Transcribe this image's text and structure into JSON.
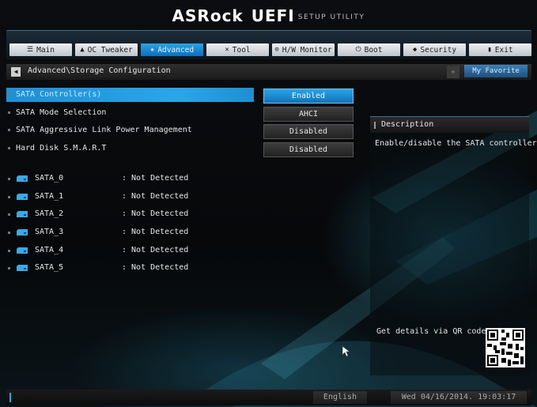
{
  "header": {
    "brand": "ASRock",
    "product": "UEFI",
    "subtitle": "SETUP UTILITY"
  },
  "tabs": [
    {
      "label": "Main",
      "icon": "list-icon",
      "glyph": "☰",
      "active": false
    },
    {
      "label": "OC Tweaker",
      "icon": "rocket-icon",
      "glyph": "▲",
      "active": false
    },
    {
      "label": "Advanced",
      "icon": "star-icon",
      "glyph": "★",
      "active": true
    },
    {
      "label": "Tool",
      "icon": "tool-icon",
      "glyph": "✕",
      "active": false
    },
    {
      "label": "H/W Monitor",
      "icon": "monitor-icon",
      "glyph": "⊙",
      "active": false
    },
    {
      "label": "Boot",
      "icon": "power-icon",
      "glyph": "⏻",
      "active": false
    },
    {
      "label": "Security",
      "icon": "shield-icon",
      "glyph": "◆",
      "active": false
    },
    {
      "label": "Exit",
      "icon": "exit-icon",
      "glyph": "▮",
      "active": false
    }
  ],
  "breadcrumb": {
    "path": "Advanced\\Storage Configuration",
    "favorite_label": "My Favorite"
  },
  "settings": [
    {
      "label": "SATA Controller(s)",
      "value": "Enabled",
      "selected": true
    },
    {
      "label": "SATA Mode Selection",
      "value": "AHCI",
      "selected": false
    },
    {
      "label": "SATA Aggressive Link Power Management",
      "value": "Disabled",
      "selected": false
    },
    {
      "label": "Hard Disk S.M.A.R.T",
      "value": "Disabled",
      "selected": false
    }
  ],
  "ports": [
    {
      "name": "SATA_0",
      "status": ": Not Detected"
    },
    {
      "name": "SATA_1",
      "status": ": Not Detected"
    },
    {
      "name": "SATA_2",
      "status": ": Not Detected"
    },
    {
      "name": "SATA_3",
      "status": ": Not Detected"
    },
    {
      "name": "SATA_4",
      "status": ": Not Detected"
    },
    {
      "name": "SATA_5",
      "status": ": Not Detected"
    }
  ],
  "description": {
    "title": "Description",
    "text": "Enable/disable the SATA controllers.",
    "qr_label": "Get details via QR code"
  },
  "footer": {
    "language": "English",
    "datetime": "Wed 04/16/2014. 19:03:17"
  },
  "colors": {
    "accent": "#2aa6e8",
    "tab_active": "#1f8fd6",
    "background": "#06080a"
  }
}
